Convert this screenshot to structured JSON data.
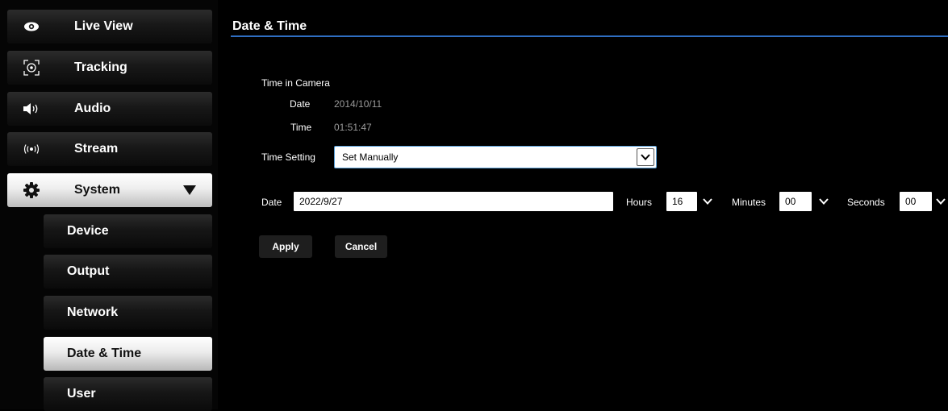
{
  "sidebar": {
    "items": [
      {
        "label": "Live View",
        "icon": "eye-icon"
      },
      {
        "label": "Tracking",
        "icon": "tracking-target-icon"
      },
      {
        "label": "Audio",
        "icon": "speaker-icon"
      },
      {
        "label": "Stream",
        "icon": "broadcast-icon"
      },
      {
        "label": "System",
        "icon": "gear-icon"
      }
    ],
    "sub_items": [
      {
        "label": "Device"
      },
      {
        "label": "Output"
      },
      {
        "label": "Network"
      },
      {
        "label": "Date & Time"
      },
      {
        "label": "User"
      }
    ]
  },
  "main": {
    "title": "Date & Time",
    "time_in_camera": {
      "heading": "Time in Camera",
      "date_label": "Date",
      "date_value": "2014/10/11",
      "time_label": "Time",
      "time_value": "01:51:47"
    },
    "time_setting": {
      "label": "Time Setting",
      "selected": "Set Manually"
    },
    "manual": {
      "date_label": "Date",
      "date_value": "2022/9/27",
      "hours_label": "Hours",
      "hours_value": "16",
      "minutes_label": "Minutes",
      "minutes_value": "00",
      "seconds_label": "Seconds",
      "seconds_value": "00"
    },
    "buttons": {
      "apply": "Apply",
      "cancel": "Cancel"
    }
  },
  "colors": {
    "accent_rule": "#2f6ec2",
    "select_border": "#5aa0d8"
  }
}
